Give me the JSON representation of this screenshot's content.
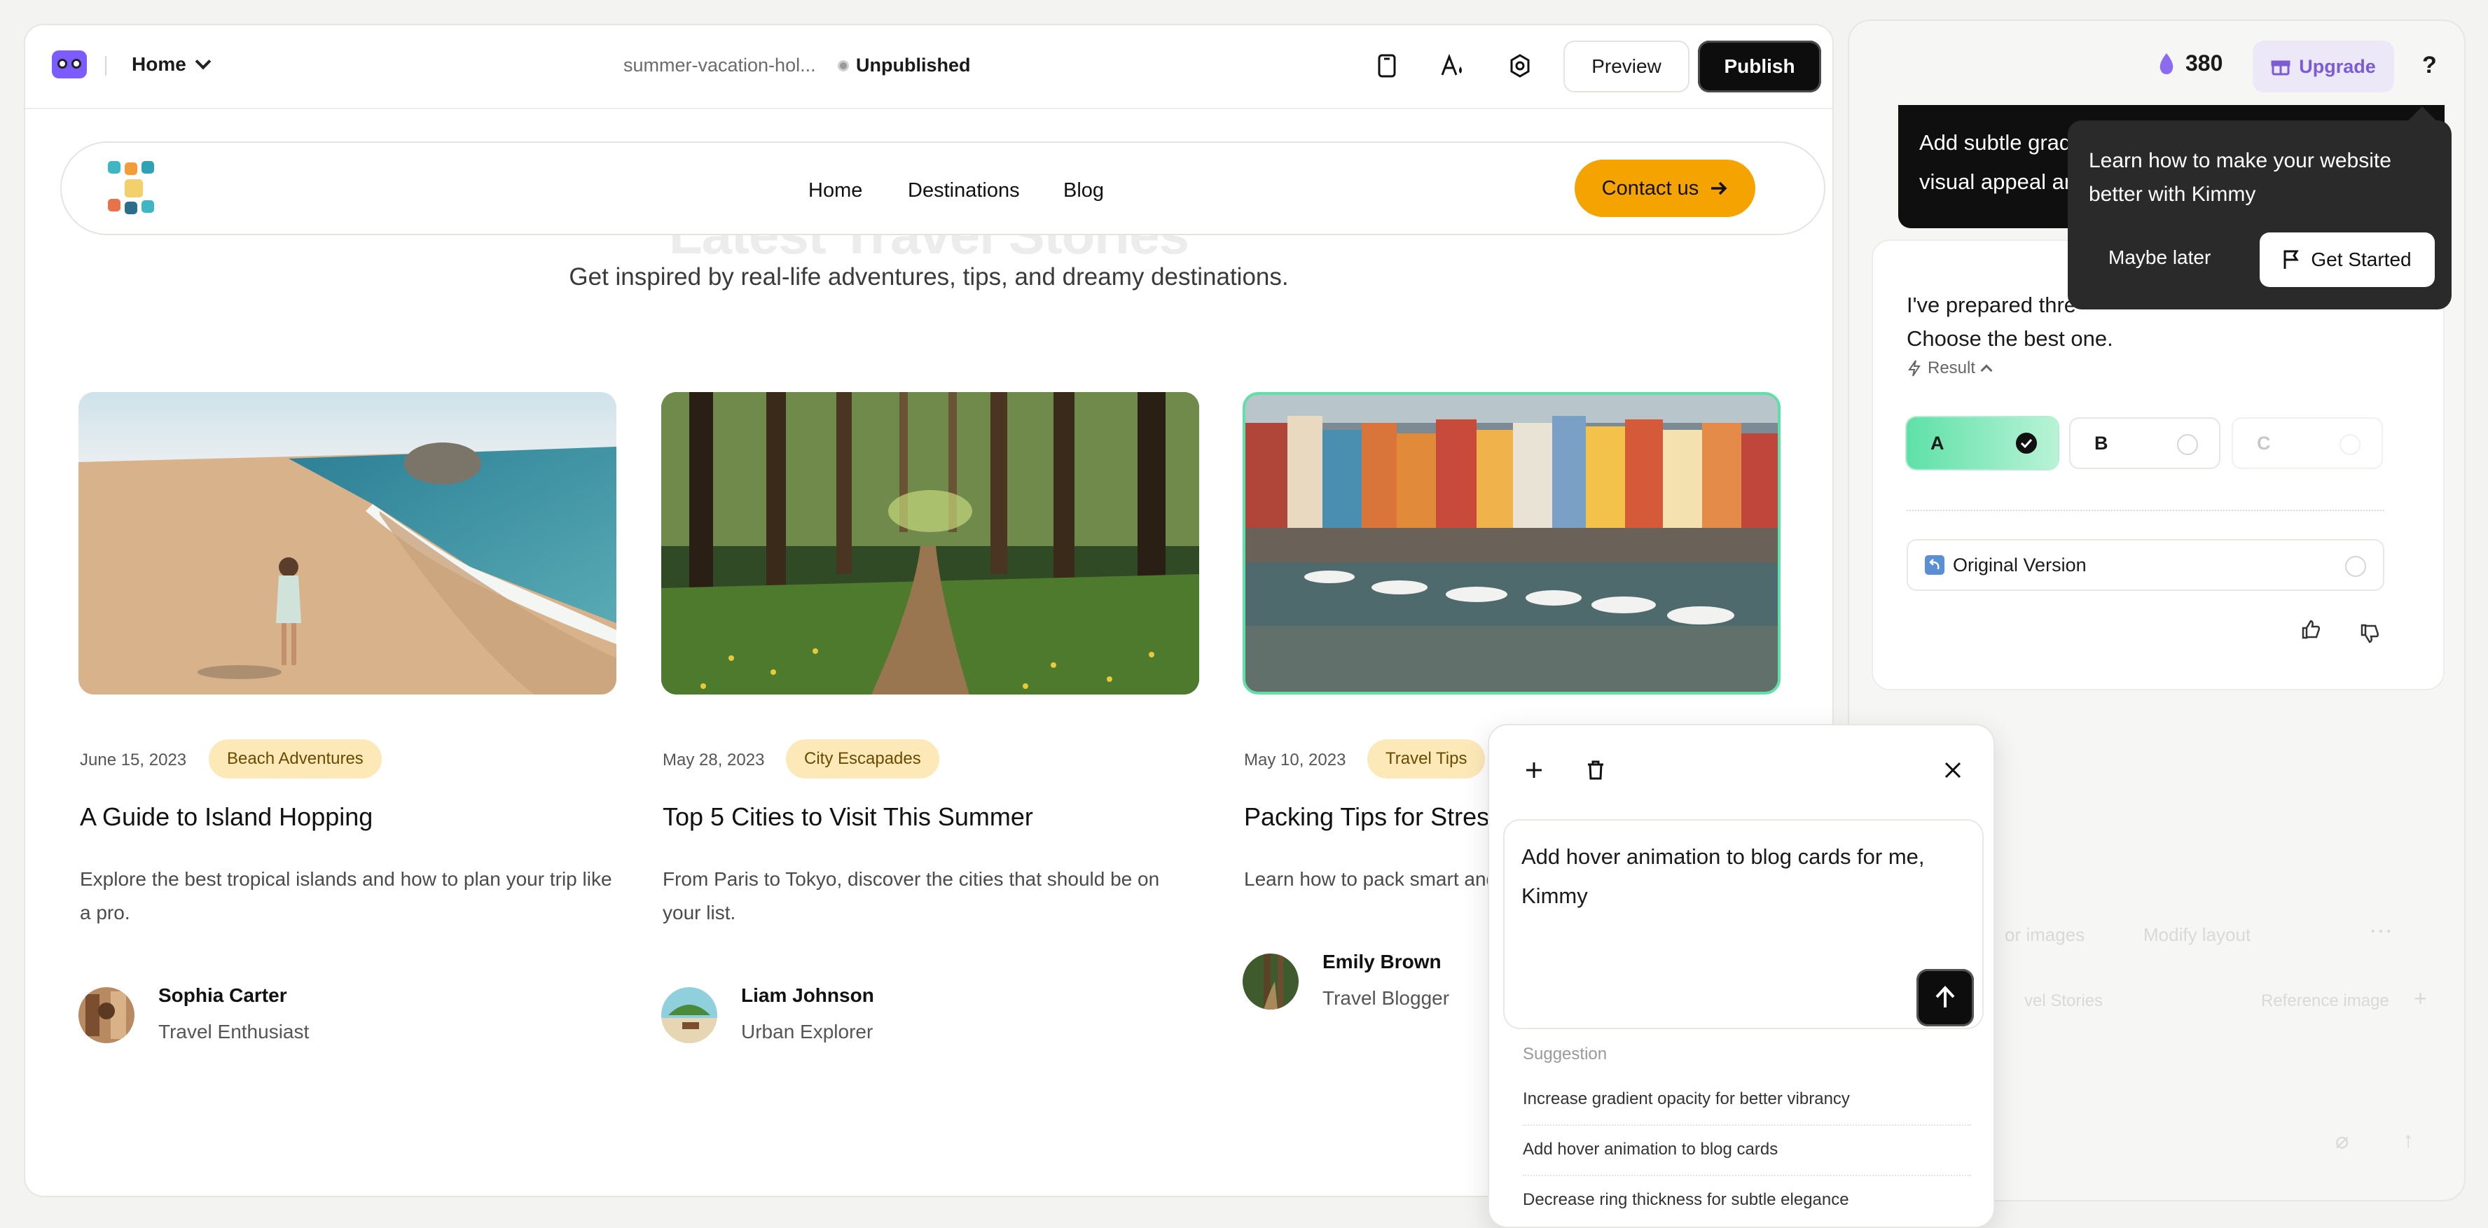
{
  "topbar": {
    "page_select": "Home",
    "slug": "summer-vacation-hol...",
    "status": "Unpublished",
    "preview_label": "Preview",
    "publish_label": "Publish"
  },
  "site": {
    "nav": [
      "Home",
      "Destinations",
      "Blog"
    ],
    "contact_label": "Contact us",
    "ghost_title": "Latest Travel Stories",
    "subtitle": "Get inspired by real-life adventures, tips, and dreamy destinations."
  },
  "cards": [
    {
      "date": "June 15, 2023",
      "tag": "Beach Adventures",
      "title": "A Guide to Island Hopping",
      "desc": "Explore the best tropical islands and how to plan your trip like a pro.",
      "author": "Sophia Carter",
      "role": "Travel Enthusiast"
    },
    {
      "date": "May 28, 2023",
      "tag": "City Escapades",
      "title": "Top 5 Cities to Visit This Summer",
      "desc": "From Paris to Tokyo, discover the cities that should be on your list.",
      "author": "Liam Johnson",
      "role": "Urban Explorer"
    },
    {
      "date": "May 10, 2023",
      "tag": "Travel Tips",
      "title": "Packing Tips for Stres",
      "desc": "Learn how to pack smart and",
      "author": "Emily Brown",
      "role": "Travel Blogger"
    }
  ],
  "chat_popup": {
    "prompt": "Add hover animation to blog cards for me, Kimmy",
    "suggestion_header": "Suggestion",
    "suggestions": [
      "Increase gradient opacity for better vibrancy",
      "Add hover animation to blog cards",
      "Decrease ring thickness for subtle elegance"
    ]
  },
  "panel": {
    "credits": "380",
    "upgrade_label": "Upgrade",
    "help": "?",
    "dark_message": "Add subtle gradient overlay on images. Enhances visual appeal and",
    "result_text_1": "I've prepared thre",
    "result_text_2": "Choose the best one.",
    "result_toggle": "Result",
    "options": [
      "A",
      "B",
      "C"
    ],
    "original_label": "Original Version",
    "faded_1": "or images",
    "faded_2": "Modify layout",
    "faded_3": "vel Stories",
    "faded_4": "Reference image"
  },
  "tooltip": {
    "text": "Learn how to make your website better with Kimmy",
    "later_label": "Maybe later",
    "start_label": "Get Started"
  },
  "colors": {
    "accent_orange": "#f5a300",
    "tag_bg": "#fde9b8",
    "upgrade_purple": "#7b5bd6",
    "selected_green": "#5fe0a8"
  }
}
